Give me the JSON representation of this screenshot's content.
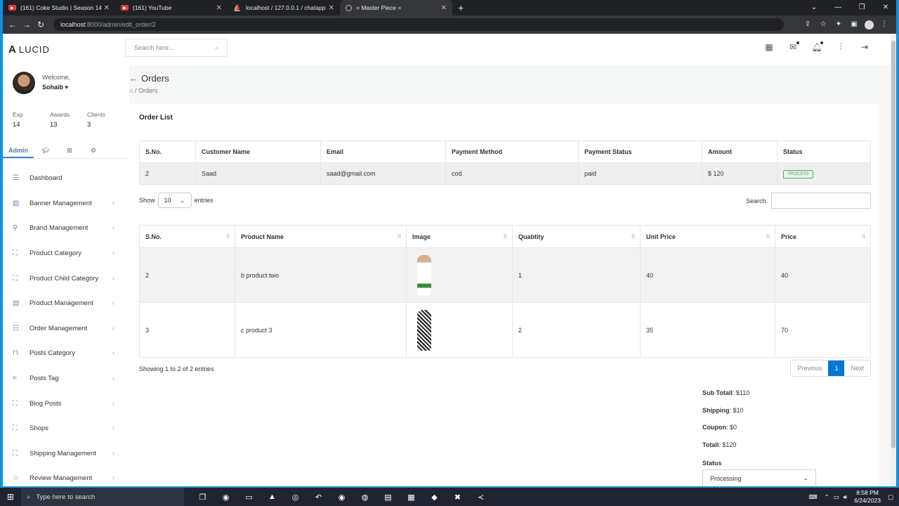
{
  "browser": {
    "tabs": [
      {
        "title": "(161) Coke Studio | Season 14 | T",
        "icon": "youtube-icon"
      },
      {
        "title": "(161) YouTube",
        "icon": "youtube-icon"
      },
      {
        "title": "localhost / 127.0.0.1 / chatapplic",
        "icon": "phpmyadmin-icon"
      },
      {
        "title": "= Master Piece =",
        "icon": "globe-icon"
      }
    ],
    "url_host": "localhost",
    "url_path": ":8000/admin/edit_order/2"
  },
  "app": {
    "brand": "LUCID",
    "search_placeholder": "Search here...",
    "user": {
      "welcome": "Welcome,",
      "name": "Sohaib ▾"
    },
    "stats": [
      {
        "label": "Exp",
        "value": "14"
      },
      {
        "label": "Awards",
        "value": "13"
      },
      {
        "label": "Clients",
        "value": "3"
      }
    ],
    "sidebar_tab_active": "Admin",
    "menu": [
      {
        "label": "Dashboard",
        "icon": "list-icon",
        "chevron": ""
      },
      {
        "label": "Banner Management",
        "icon": "image-icon",
        "chevron": "‹"
      },
      {
        "label": "Brand Management",
        "icon": "wrench-icon",
        "chevron": "‹"
      },
      {
        "label": "Product Category",
        "icon": "sitemap-icon",
        "chevron": "‹"
      },
      {
        "label": "Product Child Category",
        "icon": "sitemap-icon",
        "chevron": "‹"
      },
      {
        "label": "Product Management",
        "icon": "briefcase-icon",
        "chevron": "‹"
      },
      {
        "label": "Order Management",
        "icon": "signpost-icon",
        "chevron": "‹"
      },
      {
        "label": "Posts Category",
        "icon": "category-icon",
        "chevron": "‹"
      },
      {
        "label": "Posts Tag",
        "icon": "tag-icon",
        "chevron": "‹"
      },
      {
        "label": "Blog Posts",
        "icon": "frame-icon",
        "chevron": "‹"
      },
      {
        "label": "Shops",
        "icon": "frame-icon",
        "chevron": "‹"
      },
      {
        "label": "Shipping Management",
        "icon": "sitemap-icon",
        "chevron": "‹"
      },
      {
        "label": "Review Management",
        "icon": "star-icon",
        "chevron": "‹"
      }
    ]
  },
  "page": {
    "title": "Orders",
    "breadcrumb": "Orders",
    "card_title": "Order List"
  },
  "order_table": {
    "headers": [
      "S.No.",
      "Customer Name",
      "Email",
      "Payment Method",
      "Payment Status",
      "Amount",
      "Status"
    ],
    "row": {
      "sno": "2",
      "customer": "Saad",
      "email": "saad@gmail.com",
      "method": "cod",
      "payment_status": "paid",
      "amount": "$ 120",
      "status": "PROCESS"
    }
  },
  "controls": {
    "show_label": "Show",
    "entries_value": "10",
    "entries_label": "entries",
    "search_label": "Search:"
  },
  "product_table": {
    "headers": [
      "S.No.",
      "Product Name",
      "Image",
      "Quabtity",
      "Unit Price",
      "Price"
    ],
    "rows": [
      {
        "sno": "2",
        "name": "b product two",
        "qty": "1",
        "unit": "40",
        "price": "40"
      },
      {
        "sno": "3",
        "name": "c product 3",
        "qty": "2",
        "unit": "35",
        "price": "70"
      }
    ]
  },
  "pagination": {
    "info": "Showing 1 to 2 of 2 entries",
    "prev": "Previous",
    "current": "1",
    "next": "Next"
  },
  "totals": {
    "subtotal_label": "Sub Totall",
    "subtotal": ": $110",
    "shipping_label": "Shipping",
    "shipping": ": $10",
    "coupon_label": "Coupon",
    "coupon": ": $0",
    "total_label": "Totall",
    "total": ": $120",
    "status_label": "Status",
    "status_value": "Processing"
  },
  "taskbar": {
    "search_placeholder": "Type here to search",
    "time": "8:58 PM",
    "date": "6/24/2023"
  }
}
